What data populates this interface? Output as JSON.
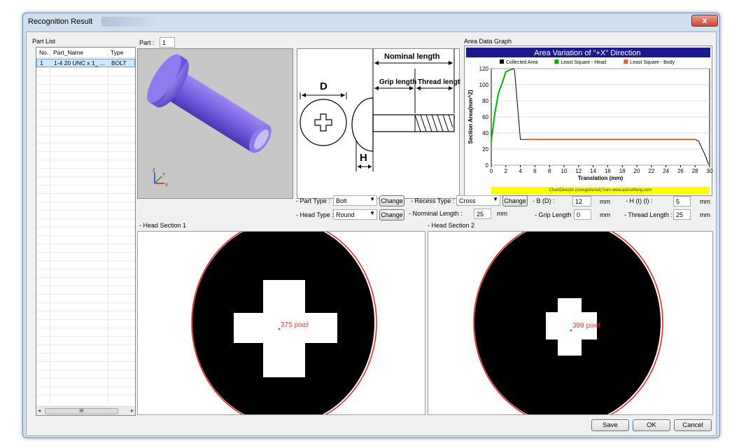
{
  "window": {
    "title": "Recognition Result",
    "close_glyph": "x"
  },
  "part_list": {
    "label": "Part List",
    "columns": [
      "No.",
      "Part_Name",
      "Type"
    ],
    "rows": [
      {
        "no": "1",
        "name": "1-4 20 UNC x 1_ ...",
        "type": "BOLT"
      }
    ],
    "scroll_thumb": "III"
  },
  "part": {
    "label": "Part :",
    "value": "1"
  },
  "axes_labels": {
    "z": "Z",
    "y": "Y",
    "x": "X"
  },
  "diagram": {
    "nominal": "Nominal length",
    "grip": "Grip length",
    "thread": "Thread length",
    "d": "D",
    "h": "H"
  },
  "graph": {
    "label": "Area Data Graph",
    "watermark": "ChartDirector (unregistered) from www.advsofteng.com"
  },
  "chart_data": {
    "type": "line",
    "title": "Area Variation of \"+X\" Direction",
    "xlabel": "Translation (mm)",
    "ylabel": "Section Area(mm^2)",
    "xlim": [
      0,
      30
    ],
    "ylim": [
      0,
      120
    ],
    "xticks": [
      0,
      2,
      4,
      6,
      8,
      10,
      12,
      14,
      16,
      18,
      20,
      22,
      24,
      26,
      28,
      30
    ],
    "yticks": [
      0,
      20,
      40,
      60,
      80,
      100,
      120
    ],
    "legend_position": "top",
    "series": [
      {
        "name": "Collected Area",
        "color": "#000000",
        "x": [
          0,
          0.5,
          1,
          1.5,
          2,
          2.5,
          3,
          3.2,
          4,
          28,
          28.5,
          29,
          29.5,
          29.8,
          30
        ],
        "y": [
          30,
          65,
          90,
          102,
          116,
          118,
          120,
          118,
          32,
          32,
          30,
          20,
          10,
          2,
          2
        ]
      },
      {
        "name": "Least Square - Head",
        "color": "#00b000",
        "x": [
          0,
          0.5,
          1,
          1.5,
          2,
          2.5
        ],
        "y": [
          30,
          65,
          90,
          102,
          116,
          118
        ]
      },
      {
        "name": "Least Square - Body",
        "color": "#d2691e",
        "x": [
          5,
          28
        ],
        "y": [
          32,
          32
        ]
      },
      {
        "name": "",
        "color": "#00b000",
        "x": [
          29.8,
          30
        ],
        "y": [
          2,
          2
        ]
      }
    ]
  },
  "form": {
    "part_type": {
      "label": "- Part Type :",
      "value": "Bolt"
    },
    "head_type": {
      "label": "- Head Type :",
      "value": "Round"
    },
    "recess_type": {
      "label": "- Recess Type :",
      "value": "Cross"
    },
    "nominal_length": {
      "label": "- Norminal Length :",
      "value": "25",
      "unit": "mm"
    },
    "b_d": {
      "label": "- B (D) :",
      "value": "12",
      "unit": "mm"
    },
    "grip_length": {
      "label": "- Grip Length :",
      "value": "0",
      "unit": "mm"
    },
    "h_t": {
      "label": "- H (t) (l) :",
      "value": "5",
      "unit": "mm"
    },
    "thread_length": {
      "label": "- Thread Length :",
      "value": "25",
      "unit": "mm"
    },
    "change_label": "Change"
  },
  "head_section_1": {
    "label": "- Head Section 1",
    "pixel_text": "375 pixel"
  },
  "head_section_2": {
    "label": "- Head Section 2",
    "pixel_text": "399 pixel"
  },
  "buttons": {
    "save": "Save",
    "ok": "OK",
    "cancel": "Cancel"
  }
}
